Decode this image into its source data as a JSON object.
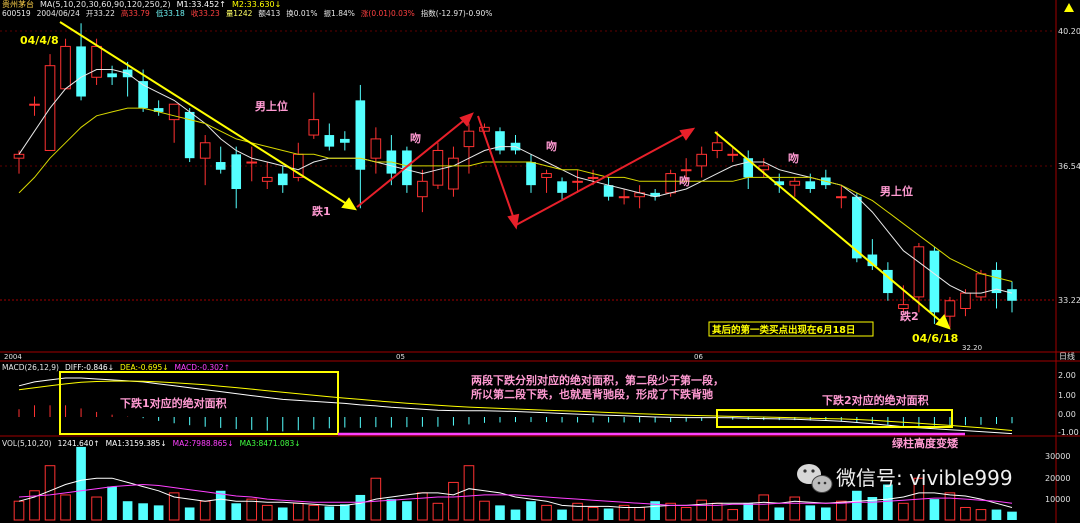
{
  "header": {
    "line1": [
      {
        "text": "贵州茅台",
        "color": "#ffd24a"
      },
      {
        "text": "MA(5,10,20,30,60,90,120,250,2)",
        "color": "#e6e6e6"
      },
      {
        "text": "M1:33.452↑",
        "color": "#ffffff"
      },
      {
        "text": "M2:33.630↓",
        "color": "#ffff00"
      }
    ],
    "line2": [
      {
        "text": "600519",
        "color": "#e6e6e6"
      },
      {
        "text": "2004/06/24",
        "color": "#e6e6e6"
      },
      {
        "text": "开33.22",
        "color": "#e6e6e6"
      },
      {
        "text": "高33.79",
        "color": "#ff4040"
      },
      {
        "text": "低33.18",
        "color": "#6ef0f0"
      },
      {
        "text": "收33.23",
        "color": "#ff4040"
      },
      {
        "text": "量1242",
        "color": "#ffff66"
      },
      {
        "text": "额413",
        "color": "#e6e6e6"
      },
      {
        "text": "换0.01%",
        "color": "#e6e6e6"
      },
      {
        "text": "振1.84%",
        "color": "#e6e6e6"
      },
      {
        "text": "涨(0.01)0.03%",
        "color": "#ff4040"
      },
      {
        "text": "指数(-12.97)-0.90%",
        "color": "#e6e6e6"
      }
    ]
  },
  "price_axis": {
    "labels": [
      "40.20",
      "36.54",
      "33.22"
    ],
    "ymin": 32.2,
    "ymax": 40.6,
    "low_label": "32.20"
  },
  "date_axis": {
    "labels": [
      "2004",
      "05",
      "06"
    ],
    "right_label": "日线"
  },
  "annotations": {
    "start_date": "04/4/8",
    "end_date": "04/6/18",
    "drop1": "跌1",
    "drop2": "跌2",
    "wen1": "吻",
    "wen2": "吻",
    "wen3": "吻",
    "wen4": "吻",
    "nan1": "男上位",
    "nan2": "男上位",
    "buy_note": "其后的第一类买点出现在6月18日"
  },
  "macd": {
    "header": [
      {
        "text": "MACD(26,12,9)",
        "color": "#e6e6e6"
      },
      {
        "text": "DIFF:-0.846↓",
        "color": "#ffffff"
      },
      {
        "text": "DEA:-0.695↓",
        "color": "#ffff00"
      },
      {
        "text": "MACD:-0.302↑",
        "color": "#ff40ff"
      }
    ],
    "axis_labels": [
      "2.00",
      "1.00",
      "0.00",
      "-1.00"
    ],
    "box1_label": "下跌1对应的绝对面积",
    "box2_label": "下跌2对应的绝对面积",
    "note_line1": "两段下跌分别对应的绝对面积，第二段少于第一段，",
    "note_line2": "所以第二段下跌，也就是背驰段，形成了下跌背驰",
    "green_note": "绿柱高度变矮"
  },
  "vol": {
    "header": [
      {
        "text": "VOL(5,10,20)",
        "color": "#e6e6e6"
      },
      {
        "text": "1241.640↑",
        "color": "#ffffff"
      },
      {
        "text": "MA1:3159.385↓",
        "color": "#ffffff"
      },
      {
        "text": "MA2:7988.865↓",
        "color": "#ff40ff"
      },
      {
        "text": "MA3:8471.083↓",
        "color": "#40ff40"
      }
    ],
    "axis_labels": [
      "30000",
      "20000",
      "10000"
    ]
  },
  "watermark": "微信号: vivible999",
  "colors": {
    "up": "#ff3232",
    "down": "#54ffff",
    "yellow": "#ffff00",
    "red_arrow": "#e8202a",
    "magenta": "#ff40ff",
    "pink_text": "#ff9ad2",
    "green": "#40ff40"
  },
  "chart_data": {
    "type": "candlestick",
    "candles": [
      {
        "o": 36.9,
        "h": 37.1,
        "l": 36.5,
        "c": 37.0
      },
      {
        "o": 38.3,
        "h": 38.5,
        "l": 38.0,
        "c": 38.3
      },
      {
        "o": 37.1,
        "h": 39.6,
        "l": 37.1,
        "c": 39.3
      },
      {
        "o": 38.7,
        "h": 40.0,
        "l": 38.7,
        "c": 39.8
      },
      {
        "o": 39.8,
        "h": 40.4,
        "l": 38.4,
        "c": 38.5
      },
      {
        "o": 39.0,
        "h": 40.0,
        "l": 38.8,
        "c": 39.8
      },
      {
        "o": 39.1,
        "h": 39.3,
        "l": 38.8,
        "c": 39.0
      },
      {
        "o": 39.2,
        "h": 39.4,
        "l": 38.5,
        "c": 39.0
      },
      {
        "o": 38.9,
        "h": 39.2,
        "l": 38.1,
        "c": 38.2
      },
      {
        "o": 38.2,
        "h": 38.4,
        "l": 38.0,
        "c": 38.1
      },
      {
        "o": 37.9,
        "h": 38.3,
        "l": 37.3,
        "c": 38.3
      },
      {
        "o": 38.1,
        "h": 38.2,
        "l": 36.8,
        "c": 36.9
      },
      {
        "o": 36.9,
        "h": 37.5,
        "l": 36.2,
        "c": 37.3
      },
      {
        "o": 36.8,
        "h": 37.2,
        "l": 36.5,
        "c": 36.6
      },
      {
        "o": 37.0,
        "h": 37.2,
        "l": 35.6,
        "c": 36.1
      },
      {
        "o": 36.8,
        "h": 37.2,
        "l": 36.3,
        "c": 36.8
      },
      {
        "o": 36.3,
        "h": 36.8,
        "l": 36.1,
        "c": 36.4
      },
      {
        "o": 36.5,
        "h": 36.7,
        "l": 36.0,
        "c": 36.2
      },
      {
        "o": 36.4,
        "h": 37.3,
        "l": 36.3,
        "c": 37.0
      },
      {
        "o": 37.5,
        "h": 38.6,
        "l": 37.4,
        "c": 37.9
      },
      {
        "o": 37.5,
        "h": 37.8,
        "l": 37.1,
        "c": 37.2
      },
      {
        "o": 37.4,
        "h": 37.6,
        "l": 37.1,
        "c": 37.3
      },
      {
        "o": 38.4,
        "h": 38.8,
        "l": 35.6,
        "c": 36.6
      },
      {
        "o": 36.9,
        "h": 37.7,
        "l": 36.5,
        "c": 37.4
      },
      {
        "o": 37.1,
        "h": 37.5,
        "l": 36.2,
        "c": 36.5
      },
      {
        "o": 37.1,
        "h": 37.2,
        "l": 36.0,
        "c": 36.2
      },
      {
        "o": 35.9,
        "h": 36.6,
        "l": 35.5,
        "c": 36.3
      },
      {
        "o": 36.2,
        "h": 37.3,
        "l": 36.1,
        "c": 37.1
      },
      {
        "o": 36.1,
        "h": 37.2,
        "l": 35.9,
        "c": 36.9
      },
      {
        "o": 37.2,
        "h": 37.8,
        "l": 36.5,
        "c": 37.6
      },
      {
        "o": 37.6,
        "h": 37.8,
        "l": 37.5,
        "c": 37.7
      },
      {
        "o": 37.6,
        "h": 37.7,
        "l": 37.0,
        "c": 37.1
      },
      {
        "o": 37.3,
        "h": 37.5,
        "l": 37.0,
        "c": 37.1
      },
      {
        "o": 36.8,
        "h": 37.0,
        "l": 36.0,
        "c": 36.2
      },
      {
        "o": 36.4,
        "h": 36.6,
        "l": 36.0,
        "c": 36.5
      },
      {
        "o": 36.3,
        "h": 36.4,
        "l": 35.8,
        "c": 36.0
      },
      {
        "o": 36.3,
        "h": 36.6,
        "l": 36.0,
        "c": 36.3
      },
      {
        "o": 36.4,
        "h": 36.6,
        "l": 36.2,
        "c": 36.4
      },
      {
        "o": 36.2,
        "h": 36.4,
        "l": 35.8,
        "c": 35.9
      },
      {
        "o": 35.9,
        "h": 36.1,
        "l": 35.7,
        "c": 35.9
      },
      {
        "o": 35.9,
        "h": 36.2,
        "l": 35.6,
        "c": 36.0
      },
      {
        "o": 36.0,
        "h": 36.1,
        "l": 35.8,
        "c": 35.9
      },
      {
        "o": 36.0,
        "h": 36.6,
        "l": 35.9,
        "c": 36.5
      },
      {
        "o": 36.6,
        "h": 36.9,
        "l": 36.3,
        "c": 36.6
      },
      {
        "o": 36.7,
        "h": 37.2,
        "l": 36.4,
        "c": 37.0
      },
      {
        "o": 37.1,
        "h": 37.6,
        "l": 36.9,
        "c": 37.3
      },
      {
        "o": 37.0,
        "h": 37.2,
        "l": 36.8,
        "c": 37.0
      },
      {
        "o": 36.9,
        "h": 37.1,
        "l": 36.1,
        "c": 36.4
      },
      {
        "o": 36.6,
        "h": 36.9,
        "l": 36.4,
        "c": 36.7
      },
      {
        "o": 36.3,
        "h": 36.5,
        "l": 36.0,
        "c": 36.2
      },
      {
        "o": 36.2,
        "h": 36.4,
        "l": 35.9,
        "c": 36.3
      },
      {
        "o": 36.3,
        "h": 36.5,
        "l": 36.0,
        "c": 36.1
      },
      {
        "o": 36.4,
        "h": 36.6,
        "l": 36.1,
        "c": 36.2
      },
      {
        "o": 35.9,
        "h": 36.2,
        "l": 35.6,
        "c": 35.9
      },
      {
        "o": 35.9,
        "h": 36.0,
        "l": 34.2,
        "c": 34.3
      },
      {
        "o": 34.4,
        "h": 34.8,
        "l": 34.0,
        "c": 34.1
      },
      {
        "o": 34.0,
        "h": 34.2,
        "l": 33.2,
        "c": 33.4
      },
      {
        "o": 33.0,
        "h": 33.6,
        "l": 32.9,
        "c": 33.1
      },
      {
        "o": 33.3,
        "h": 34.7,
        "l": 32.9,
        "c": 34.6
      },
      {
        "o": 34.5,
        "h": 34.6,
        "l": 32.6,
        "c": 32.9
      },
      {
        "o": 32.8,
        "h": 33.3,
        "l": 32.5,
        "c": 33.2
      },
      {
        "o": 33.0,
        "h": 33.5,
        "l": 32.8,
        "c": 33.4
      },
      {
        "o": 33.3,
        "h": 34.0,
        "l": 33.2,
        "c": 33.9
      },
      {
        "o": 34.0,
        "h": 34.2,
        "l": 33.0,
        "c": 33.4
      },
      {
        "o": 33.5,
        "h": 33.7,
        "l": 32.9,
        "c": 33.2
      }
    ],
    "ma_fast": [
      37.0,
      37.6,
      38.2,
      38.7,
      39.0,
      39.2,
      39.2,
      39.1,
      38.8,
      38.6,
      38.4,
      38.1,
      37.8,
      37.4,
      37.1,
      36.9,
      36.8,
      36.7,
      36.6,
      36.8,
      36.9,
      36.9,
      36.9,
      36.8,
      36.7,
      36.6,
      36.5,
      36.6,
      36.7,
      36.9,
      37.1,
      37.2,
      37.2,
      37.0,
      36.8,
      36.6,
      36.4,
      36.3,
      36.2,
      36.1,
      36.0,
      35.9,
      36.0,
      36.1,
      36.3,
      36.5,
      36.7,
      36.8,
      36.8,
      36.6,
      36.5,
      36.4,
      36.3,
      36.2,
      35.9,
      35.5,
      35.0,
      34.5,
      34.2,
      33.9,
      33.6,
      33.4,
      33.4,
      33.5,
      33.4
    ],
    "ma_slow": [
      36.0,
      36.4,
      36.9,
      37.3,
      37.7,
      38.0,
      38.1,
      38.2,
      38.2,
      38.1,
      38.0,
      37.9,
      37.8,
      37.6,
      37.4,
      37.3,
      37.2,
      37.1,
      37.0,
      37.0,
      36.9,
      36.9,
      36.9,
      36.8,
      36.8,
      36.7,
      36.7,
      36.7,
      36.7,
      36.7,
      36.8,
      36.8,
      36.8,
      36.8,
      36.7,
      36.6,
      36.6,
      36.5,
      36.4,
      36.4,
      36.3,
      36.3,
      36.3,
      36.3,
      36.3,
      36.3,
      36.3,
      36.4,
      36.4,
      36.4,
      36.4,
      36.4,
      36.3,
      36.2,
      36.0,
      35.8,
      35.5,
      35.2,
      34.9,
      34.6,
      34.3,
      34.1,
      33.9,
      33.8,
      33.7
    ],
    "diff": [
      1.6,
      1.8,
      1.9,
      2.0,
      2.0,
      1.95,
      1.9,
      1.85,
      1.8,
      1.7,
      1.6,
      1.5,
      1.4,
      1.3,
      1.2,
      1.1,
      1.0,
      0.9,
      0.85,
      0.8,
      0.75,
      0.7,
      0.62,
      0.57,
      0.5,
      0.45,
      0.4,
      0.35,
      0.33,
      0.32,
      0.32,
      0.3,
      0.28,
      0.25,
      0.22,
      0.18,
      0.15,
      0.12,
      0.09,
      0.06,
      0.03,
      0.0,
      -0.02,
      -0.03,
      -0.03,
      -0.03,
      -0.04,
      -0.06,
      -0.08,
      -0.1,
      -0.12,
      -0.15,
      -0.18,
      -0.22,
      -0.28,
      -0.35,
      -0.42,
      -0.5,
      -0.55,
      -0.6,
      -0.65,
      -0.7,
      -0.75,
      -0.8,
      -0.85
    ],
    "dea": [
      1.4,
      1.5,
      1.6,
      1.7,
      1.78,
      1.82,
      1.84,
      1.84,
      1.83,
      1.8,
      1.76,
      1.71,
      1.65,
      1.58,
      1.51,
      1.43,
      1.35,
      1.27,
      1.19,
      1.12,
      1.04,
      0.97,
      0.9,
      0.83,
      0.77,
      0.71,
      0.65,
      0.6,
      0.55,
      0.51,
      0.47,
      0.44,
      0.41,
      0.38,
      0.35,
      0.32,
      0.29,
      0.26,
      0.23,
      0.2,
      0.17,
      0.14,
      0.11,
      0.09,
      0.07,
      0.05,
      0.03,
      0.01,
      0.0,
      -0.02,
      -0.04,
      -0.06,
      -0.08,
      -0.1,
      -0.13,
      -0.17,
      -0.22,
      -0.27,
      -0.32,
      -0.38,
      -0.43,
      -0.49,
      -0.55,
      -0.62,
      -0.69
    ],
    "macd_hist": [
      0.4,
      0.6,
      0.6,
      0.6,
      0.44,
      0.26,
      0.12,
      0.02,
      -0.06,
      -0.2,
      -0.32,
      -0.42,
      -0.5,
      -0.56,
      -0.62,
      -0.66,
      -0.7,
      -0.74,
      -0.68,
      -0.64,
      -0.58,
      -0.54,
      -0.56,
      -0.52,
      -0.54,
      -0.52,
      -0.5,
      -0.5,
      -0.44,
      -0.38,
      -0.3,
      -0.28,
      -0.26,
      -0.26,
      -0.26,
      -0.28,
      -0.28,
      -0.28,
      -0.28,
      -0.28,
      -0.28,
      -0.28,
      -0.26,
      -0.24,
      -0.2,
      -0.16,
      -0.14,
      -0.14,
      -0.16,
      -0.16,
      -0.16,
      -0.18,
      -0.2,
      -0.24,
      -0.3,
      -0.36,
      -0.4,
      -0.46,
      -0.46,
      -0.44,
      -0.44,
      -0.42,
      -0.4,
      -0.36,
      -0.32
    ],
    "volume": [
      9000,
      14000,
      26000,
      12000,
      35000,
      11000,
      16000,
      9000,
      8000,
      7000,
      13000,
      6000,
      9000,
      14000,
      8000,
      10000,
      7000,
      6000,
      8000,
      7000,
      6500,
      7500,
      12000,
      20000,
      10000,
      9000,
      13000,
      8000,
      18000,
      26000,
      9000,
      7000,
      5000,
      9000,
      7000,
      5000,
      8000,
      6000,
      5500,
      7000,
      6000,
      9000,
      8000,
      6000,
      9500,
      8000,
      5000,
      8000,
      12000,
      6000,
      11000,
      7000,
      6000,
      9000,
      14000,
      11000,
      17000,
      8000,
      20000,
      10000,
      13000,
      6000,
      5000,
      5000,
      4000
    ],
    "vol_ma1": [
      9000,
      11000,
      14000,
      17000,
      19000,
      20000,
      20000,
      18000,
      16000,
      14000,
      11000,
      10000,
      9000,
      10000,
      9000,
      9000,
      8500,
      8500,
      8000,
      7500,
      7000,
      7000,
      8000,
      10000,
      11000,
      12000,
      13000,
      13000,
      12000,
      15000,
      14000,
      13000,
      11000,
      10000,
      9000,
      7000,
      6500,
      6500,
      6500,
      6000,
      6000,
      6500,
      7000,
      7000,
      7500,
      8000,
      8000,
      8000,
      8500,
      8000,
      9000,
      8500,
      8000,
      8500,
      9000,
      9500,
      10000,
      11000,
      13000,
      13000,
      12000,
      11500,
      10000,
      8000,
      6000
    ],
    "vol_ma2": [
      11000,
      11500,
      12000,
      13000,
      14000,
      15000,
      16000,
      16500,
      17000,
      16500,
      15500,
      14500,
      13500,
      12500,
      11500,
      11000,
      10000,
      9500,
      9000,
      8500,
      8500,
      8500,
      8500,
      9000,
      9500,
      10000,
      10500,
      11000,
      11000,
      11500,
      12000,
      12000,
      12000,
      11500,
      11000,
      10500,
      10000,
      9500,
      9000,
      8500,
      8000,
      7500,
      7000,
      7000,
      7000,
      7000,
      7500,
      7500,
      7500,
      8000,
      8000,
      8000,
      8000,
      8000,
      8500,
      8500,
      9000,
      9500,
      10000,
      10500,
      10500,
      10000,
      9500,
      9000,
      8000
    ]
  }
}
